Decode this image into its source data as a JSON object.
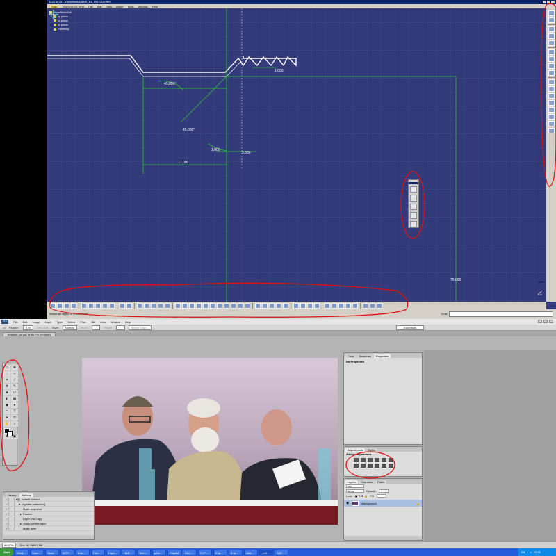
{
  "catia": {
    "title": "[CATIA V5 - [DoveShieldLibNS_B1_FIN.CATPart]]",
    "menu": [
      "Start",
      "ENOVIA V5 VPM",
      "File",
      "Edit",
      "View",
      "Insert",
      "Tools",
      "Window",
      "Help"
    ],
    "tree": {
      "root": "DoveShieldLib",
      "children": [
        "xy plane",
        "yz plane",
        "zx plane",
        "PartBody"
      ]
    },
    "dimensions": {
      "angle1": "45,000°",
      "angle2": "45,000°",
      "d1": "1,000",
      "d2": "1,000",
      "d3": "3,000",
      "d4": "17,000",
      "d5": "75,000"
    },
    "status_text": "Select an object or a command",
    "command_label": "Cmd:",
    "logo": "CATIA"
  },
  "photoshop": {
    "logo": "Ps",
    "menu": [
      "File",
      "Edit",
      "Image",
      "Layer",
      "Type",
      "Select",
      "Filter",
      "3D",
      "View",
      "Window",
      "Help"
    ],
    "options": {
      "feather_label": "Feather:",
      "feather_value": "0 px",
      "antialias": "Anti-alias",
      "style_label": "Style:",
      "style_value": "Normal",
      "width_label": "Width:",
      "height_label": "Height:",
      "refine": "Refine Edge...",
      "workspace": "Essentials"
    },
    "doc_tab": "m38990_ps.jpg @ 66,7% (RGB/8*)",
    "history_panel": {
      "tabs": [
        "History",
        "Actions"
      ],
      "rows": [
        {
          "label": "Default Actions",
          "indent": 0,
          "selected": false
        },
        {
          "label": "Vignette (selection)",
          "indent": 1,
          "selected": false
        },
        {
          "label": "Make snapshot",
          "indent": 2,
          "selected": false
        },
        {
          "label": "Feather",
          "indent": 2,
          "selected": false
        },
        {
          "label": "Layer Via Copy",
          "indent": 2,
          "selected": false
        },
        {
          "label": "Show current layer",
          "indent": 2,
          "selected": false
        },
        {
          "label": "Make layer",
          "indent": 2,
          "selected": false
        }
      ]
    },
    "properties_panel": {
      "tabs": [
        "Color",
        "Swatches",
        "Properties"
      ],
      "text": "No Properties"
    },
    "adjustments_panel": {
      "tabs": [
        "Adjustments",
        "Styles"
      ],
      "text": "Add an adjustment"
    },
    "layers_panel": {
      "tabs": [
        "Layers",
        "Channels",
        "Paths"
      ],
      "kind": "Kind",
      "blend": "Normal",
      "opacity_label": "Opacity:",
      "lock_label": "Lock:",
      "fill_label": "Fill:",
      "layer_name": "Background"
    },
    "status": {
      "zoom": "66,67%",
      "doc": "Doc: 61,9M/61,9M"
    }
  },
  "taskbar": {
    "start": "Start",
    "tasks": [
      "Wind...",
      "Com...",
      "Sezn...",
      "BITP...",
      "Kon...",
      "Пол...",
      "Горо...",
      "HAS...",
      "Tech...",
      "µTor...",
      "Playlist",
      "VLC ...",
      "C:\\P...",
      "Е:\\р...",
      "Е:\\р...",
      "Unti...",
      "_m3...",
      "CAT..."
    ],
    "lang": "EN",
    "time": "15:15"
  }
}
